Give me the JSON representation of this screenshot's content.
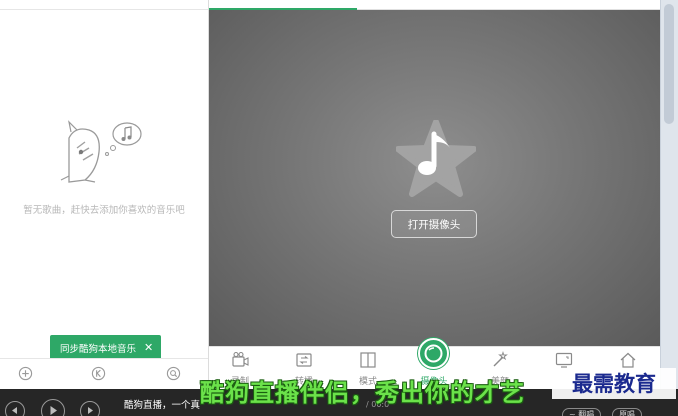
{
  "tabs": [
    {
      "label": "",
      "active": true
    },
    {
      "label": "",
      "active": false
    },
    {
      "label": "",
      "active": false
    }
  ],
  "playlist": {
    "empty_message": "暂无歌曲，赶快去添加你喜欢的音乐吧",
    "sync_button_label": "同步酷狗本地音乐",
    "sync_close_glyph": "✕"
  },
  "preview": {
    "open_camera_label": "打开摄像头"
  },
  "toolbar": [
    {
      "id": "record",
      "label": "录制"
    },
    {
      "id": "scene",
      "label": "转播"
    },
    {
      "id": "mode",
      "label": "模式"
    },
    {
      "id": "camera",
      "label": "摄像头",
      "active": true
    },
    {
      "id": "beauty",
      "label": "美颜"
    },
    {
      "id": "screen",
      "label": ""
    },
    {
      "id": "home",
      "label": ""
    }
  ],
  "player": {
    "now_playing": "酷狗直播，一个真",
    "time": "/ 00:0",
    "pill_1": "~ 翻唱",
    "pill_2": "原唱"
  },
  "overlay": {
    "caption": "酷狗直播伴侣，秀出你的才艺",
    "watermark": "最需教育"
  },
  "colors": {
    "accent": "#2ea867",
    "caption": "#6be24a",
    "watermark": "#1b2a8f"
  }
}
